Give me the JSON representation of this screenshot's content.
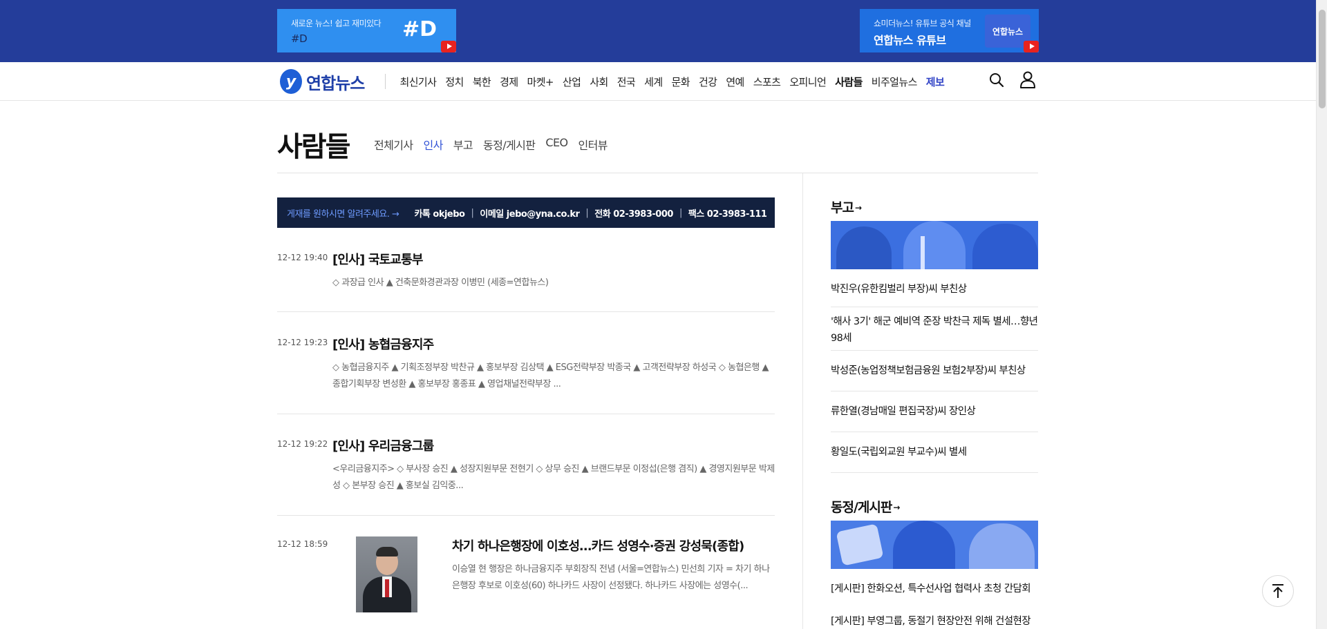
{
  "promo": {
    "left": {
      "line1": "새로운 뉴스! 쉽고 재미있다",
      "line2": "#D",
      "logo": "#D"
    },
    "right": {
      "line1": "쇼미더뉴스! 유튜브 공식 채널",
      "line2": "연합뉴스 유튜브",
      "chip": "연합뉴스"
    }
  },
  "nav": {
    "logo": "연합뉴스",
    "logo_mark": "y",
    "items": [
      "최신기사",
      "정치",
      "북한",
      "경제",
      "마켓+",
      "산업",
      "사회",
      "전국",
      "세계",
      "문화",
      "건강",
      "연예",
      "스포츠",
      "오피니언",
      "사람들",
      "비주얼뉴스",
      "제보"
    ],
    "active": "사람들",
    "accent": "제보"
  },
  "section": {
    "title": "사람들",
    "tabs": [
      "전체기사",
      "인사",
      "부고",
      "동정/게시판",
      "CEO",
      "인터뷰"
    ],
    "active_tab": "인사"
  },
  "infobar": {
    "highlight": "게재를 원하시면 알려주세요. →",
    "items": [
      "카톡 okjebo",
      "이메일 jebo@yna.co.kr",
      "전화 02-3983-000",
      "팩스 02-3983-111"
    ]
  },
  "articles": [
    {
      "time": "12-12 19:40",
      "title": "[인사] 국토교통부",
      "summary": "◇ 과장급 인사 ▲ 건축문화경관과장 이병민 (세종=연합뉴스)"
    },
    {
      "time": "12-12 19:23",
      "title": "[인사] 농협금융지주",
      "summary": "◇ 농협금융지주 ▲ 기획조정부장 박찬규 ▲ 홍보부장 김상택 ▲ ESG전략부장 박종국 ▲ 고객전략부장 하성국 ◇ 농협은행 ▲ 종합기획부장 변성환 ▲ 홍보부장 홍종표 ▲ 영업채널전략부장 ..."
    },
    {
      "time": "12-12 19:22",
      "title": "[인사] 우리금융그룹",
      "summary": "<우리금융지주> ◇ 부사장 승진 ▲ 성장지원부문 전현기 ◇ 상무 승진 ▲ 브랜드부문 이정섭(은행 겸직) ▲ 경영지원부문 박제성 ◇ 본부장 승진 ▲ 홍보실 김익중..."
    },
    {
      "time": "12-12 18:59",
      "title": "차기 하나은행장에 이호성…카드 성영수·증권 강성묵(종합)",
      "summary": "이승열 현 행장은 하나금융지주 부회장직 전념 (서울=연합뉴스) 민선희 기자 = 차기 하나은행장 후보로 이호성(60) 하나카드 사장이 선정됐다. 하나카드 사장에는 성영수(..."
    }
  ],
  "sidebar": {
    "obituary": {
      "heading": "부고",
      "arrow": "→",
      "items": [
        "박진우(유한킴벌리 부장)씨 부친상",
        "'해사 3기' 해군 예비역 준장 박찬극 제독 별세…향년 98세",
        "박성준(농업정책보험금융원 보험2부장)씨 부친상",
        "류한열(경남매일 편집국장)씨 장인상",
        "황일도(국립외교원 부교수)씨 별세"
      ]
    },
    "board": {
      "heading": "동정/게시판",
      "arrow": "→",
      "items": [
        "[게시판] 한화오션, 특수선사업 협력사 초청 간담회",
        "[게시판] 부영그룹, 동절기 현장안전 위해 건설현장"
      ]
    }
  }
}
